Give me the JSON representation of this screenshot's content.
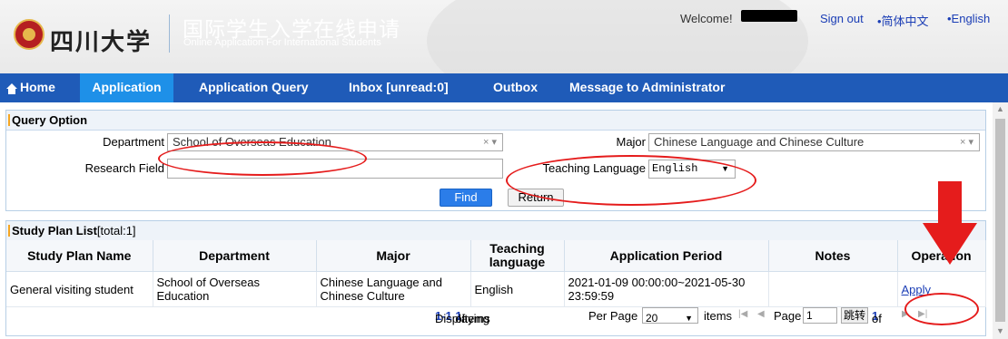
{
  "header": {
    "university_name": "四川大学",
    "title_cn": "国际学生入学在线申请",
    "title_en": "Online Application For International Students",
    "welcome": "Welcome!",
    "sign_out": "Sign out",
    "lang_cn": "•简体中文",
    "lang_en": "•English"
  },
  "nav": {
    "home": "Home",
    "items": [
      "Application",
      "Application Query",
      "Inbox [unread:0]",
      "Outbox",
      "Message to Administrator"
    ]
  },
  "query": {
    "title": "Query Option",
    "department_label": "Department",
    "department_value": "School of Overseas Education",
    "major_label": "Major",
    "major_value": "Chinese Language and Chinese Culture",
    "research_label": "Research Field",
    "research_value": "",
    "teaching_label": "Teaching Language",
    "teaching_value": "English",
    "find": "Find",
    "return": "Return"
  },
  "list": {
    "title": "Study Plan List",
    "total": "[total:1]",
    "columns": [
      "Study Plan Name",
      "Department",
      "Major",
      "Teaching language",
      "Application Period",
      "Notes",
      "Operation"
    ],
    "rows": [
      {
        "name": "General visiting student",
        "department": "School of Overseas Education",
        "major": "Chinese Language and Chinese Culture",
        "language": "English",
        "period": "2021-01-09 00:00:00~2021-05-30 23:59:59",
        "notes": "",
        "operation": "Apply"
      }
    ]
  },
  "pager": {
    "displaying": "Displaying",
    "range": "1-1",
    "of": "of",
    "total": "1",
    "items": "items",
    "per_page": "Per Page",
    "per_page_value": "20",
    "items2": "items",
    "page": "Page",
    "page_value": "1",
    "jump": "跳转",
    "of_pages": "of",
    "pages_total": "1"
  },
  "colors": {
    "nav_bg": "#1f5bb8",
    "nav_active": "#1e90e8",
    "annotation": "#e51c1c"
  }
}
